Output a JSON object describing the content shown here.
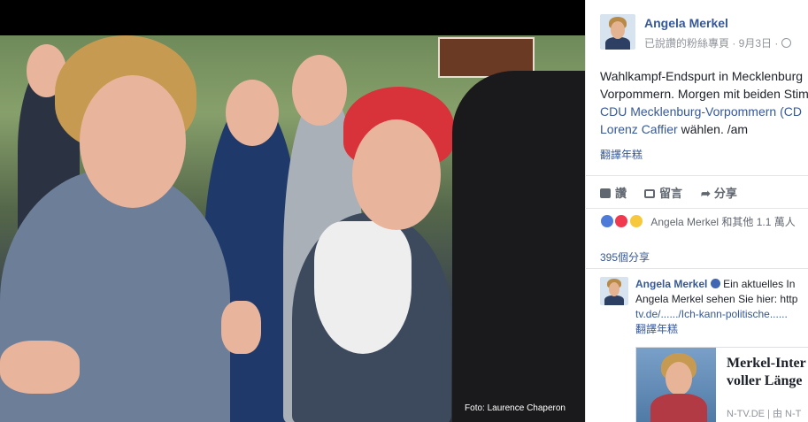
{
  "photo": {
    "credit": "Foto: Laurence Chaperon"
  },
  "post": {
    "author": "Angela Merkel",
    "meta": "已說讚的粉絲專頁 · 9月3日 ·",
    "text_lines": [
      "Wahlkampf-Endspurt in Mecklenburg",
      "Vorpommern. Morgen mit beiden Stim"
    ],
    "link_lines": [
      "CDU Mecklenburg-Vorpommern (CD",
      "Lorenz Caffier"
    ],
    "text_tail": " wählen. /am",
    "translate": "翻譯年糕"
  },
  "actions": {
    "like": "讚",
    "comment": "留言",
    "share": "分享"
  },
  "reactions": {
    "text": "Angela Merkel 和其他 1.1 萬人"
  },
  "shares": "395個分享",
  "comment": {
    "author": "Angela Merkel",
    "line1_tail": "Ein aktuelles In",
    "line2": "Angela Merkel sehen Sie hier: http",
    "line3": "tv.de/....../Ich-kann-politische......",
    "translate": "翻譯年糕"
  },
  "card": {
    "title_lines": [
      "Merkel-Inter",
      "voller Länge"
    ],
    "source": "N-TV.DE | 由 N-T"
  },
  "colors": {
    "link": "#365899",
    "text": "#1d2129",
    "muted": "#90949c"
  }
}
